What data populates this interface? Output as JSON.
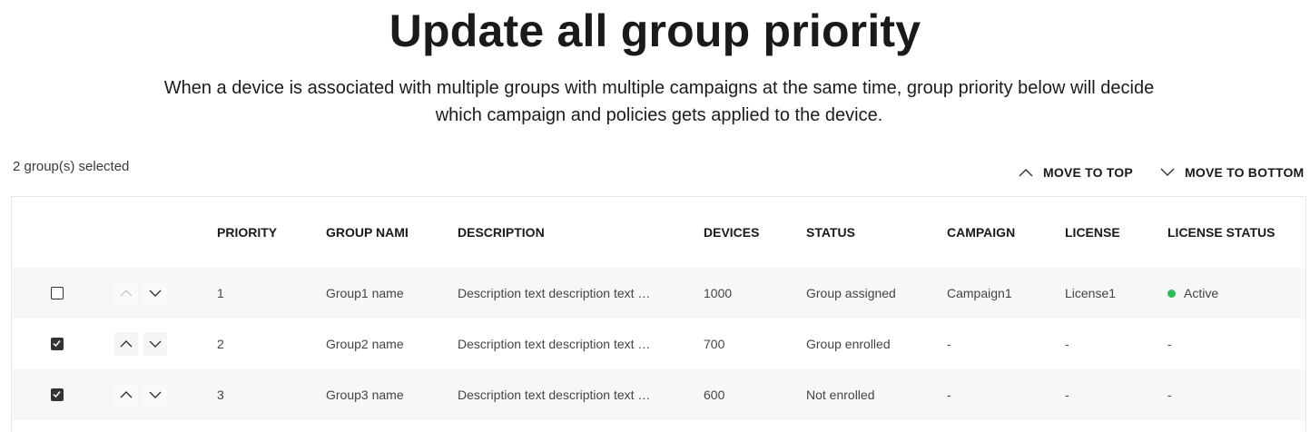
{
  "page": {
    "title": "Update all group priority",
    "description": "When a device is associated with multiple groups with multiple campaigns at the same time, group priority below will decide which campaign and policies gets applied to the device."
  },
  "toolbar": {
    "selected_count": "2 group(s) selected",
    "move_to_top": "MOVE TO TOP",
    "move_to_bottom": "MOVE TO BOTTOM"
  },
  "table": {
    "headers": {
      "priority": "PRIORITY",
      "group_name": "GROUP NAME",
      "description": "DESCRIPTION",
      "devices": "DEVICES",
      "status": "STATUS",
      "campaign": "CAMPAIGN",
      "license": "LICENSE",
      "license_status": "LICENSE STATUS"
    },
    "rows": [
      {
        "checked": false,
        "up_enabled": false,
        "down_enabled": true,
        "priority": "1",
        "group_name": "Group1 name",
        "description": "Description text description text description text",
        "devices": "1000",
        "status": "Group assigned",
        "campaign": "Campaign1",
        "license": "License1",
        "license_status": "Active"
      },
      {
        "checked": true,
        "up_enabled": true,
        "down_enabled": true,
        "priority": "2",
        "group_name": "Group2 name",
        "description": "Description text description text description text",
        "devices": "700",
        "status": "Group enrolled",
        "campaign": "-",
        "license": "-",
        "license_status": "-"
      },
      {
        "checked": true,
        "up_enabled": true,
        "down_enabled": true,
        "priority": "3",
        "group_name": "Group3 name",
        "description": "Description text description text description text",
        "devices": "600",
        "status": "Not enrolled",
        "campaign": "-",
        "license": "-",
        "license_status": "-"
      }
    ]
  },
  "icons": {
    "move_to_top": "chevron-up-icon",
    "move_to_bottom": "chevron-down-icon",
    "row_up": "chevron-up-icon",
    "row_down": "chevron-down-icon",
    "checkbox_checked": "check-icon",
    "status_active": "status-dot-icon"
  },
  "colors": {
    "active_dot": "#2bbf58",
    "row_stripe": "#f7f7f7",
    "border": "#e6e6e6",
    "disabled_icon": "#c8c8c8"
  }
}
